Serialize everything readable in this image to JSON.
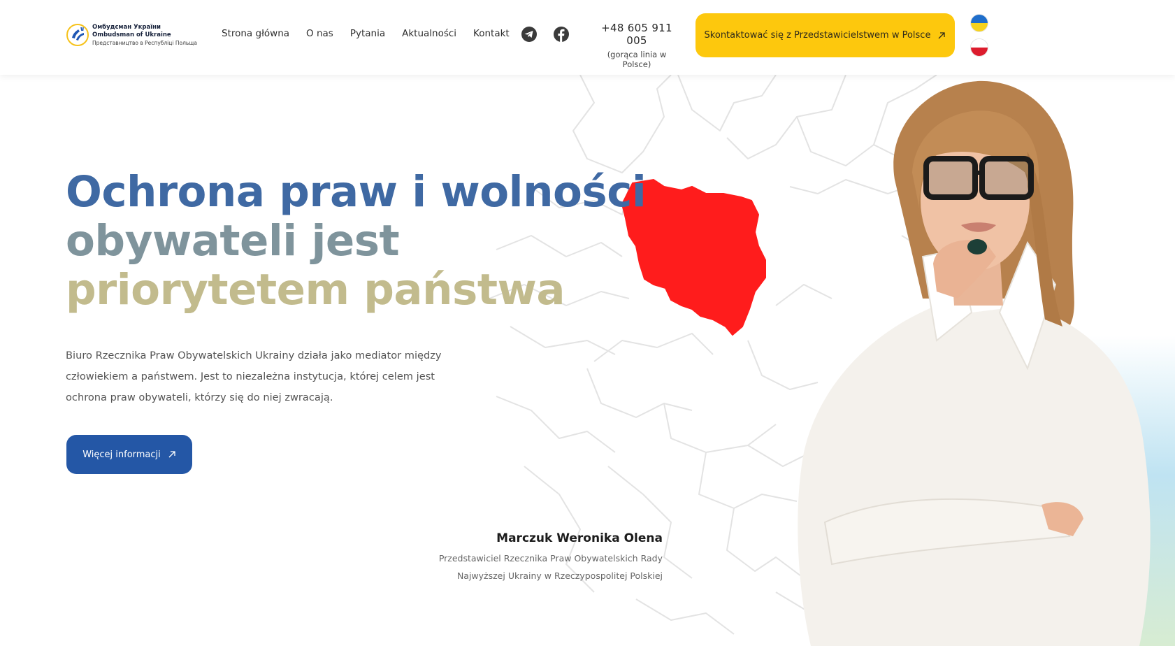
{
  "logo": {
    "line1": "Омбудсман України",
    "line2": "Ombudsman of Ukraine",
    "line3": "Представництво в Республіці Польща"
  },
  "nav": {
    "items": [
      "Strona główna",
      "O nas",
      "Pytania",
      "Aktualności",
      "Kontakt"
    ]
  },
  "social": {
    "icons": [
      "telegram-icon",
      "facebook-icon"
    ]
  },
  "phone": {
    "number": "+48 605 911 005",
    "caption": "(gorąca linia w Polsce)"
  },
  "cta": {
    "label": "Skontaktować się z Przedstawicielstwem w Polsce",
    "icon": "arrow-up-right-icon"
  },
  "languages": [
    {
      "code": "ua",
      "colors": [
        "#1f6ecb",
        "#f6d21e"
      ]
    },
    {
      "code": "pl",
      "colors": [
        "#ffffff",
        "#dc1c2d"
      ]
    }
  ],
  "hero": {
    "headline": {
      "line1": "Ochrona praw i wolności",
      "line2": "obywateli jest",
      "line3": "priorytetem państwa"
    },
    "lead": "Biuro Rzecznika Praw Obywatelskich Ukrainy działa jako mediator między człowiekiem a państwem. Jest to niezależna instytucja, której celem jest ochrona praw obywateli, którzy się do niej zwracają.",
    "button": "Więcej informacji",
    "person_name": "Marczuk Weronika Olena",
    "person_role_line1": "Przedstawiciel Rzecznika Praw Obywatelskich Rady",
    "person_role_line2": "Najwyższej Ukrainy w Rzeczypospolitej Polskiej"
  },
  "colors": {
    "accent_yellow": "#fdc80d",
    "accent_blue": "#2457a6",
    "headline_blue": "#3f69a3",
    "headline_gray": "#7f949c",
    "headline_gold": "#c2bb8d",
    "poland_red": "#ff1c1c"
  }
}
